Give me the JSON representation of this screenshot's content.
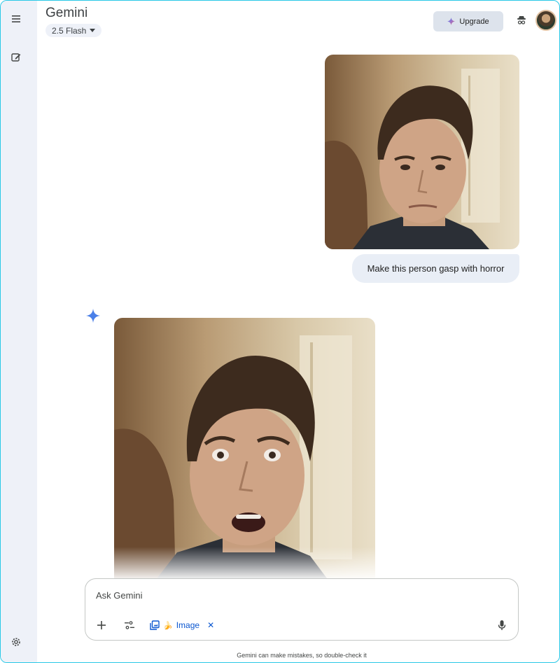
{
  "header": {
    "title": "Gemini",
    "model": "2.5 Flash",
    "upgrade_label": "Upgrade"
  },
  "sidebar": {
    "icons": [
      "menu-icon",
      "new-chat-icon",
      "settings-icon"
    ]
  },
  "chat": {
    "user_message": "Make this person gasp with horror",
    "user_image_desc": "man-neutral-expression",
    "result_image_desc": "man-gasping-horror"
  },
  "input": {
    "placeholder": "Ask Gemini",
    "tool_label": "Image"
  },
  "footer": {
    "disclaimer": "Gemini can make mistakes, so double-check it"
  },
  "colors": {
    "accent_blue": "#0b57d0",
    "sidebar_bg": "#eef1f8",
    "bubble_bg": "#e9eef6",
    "frame_border": "#28c8e6"
  }
}
